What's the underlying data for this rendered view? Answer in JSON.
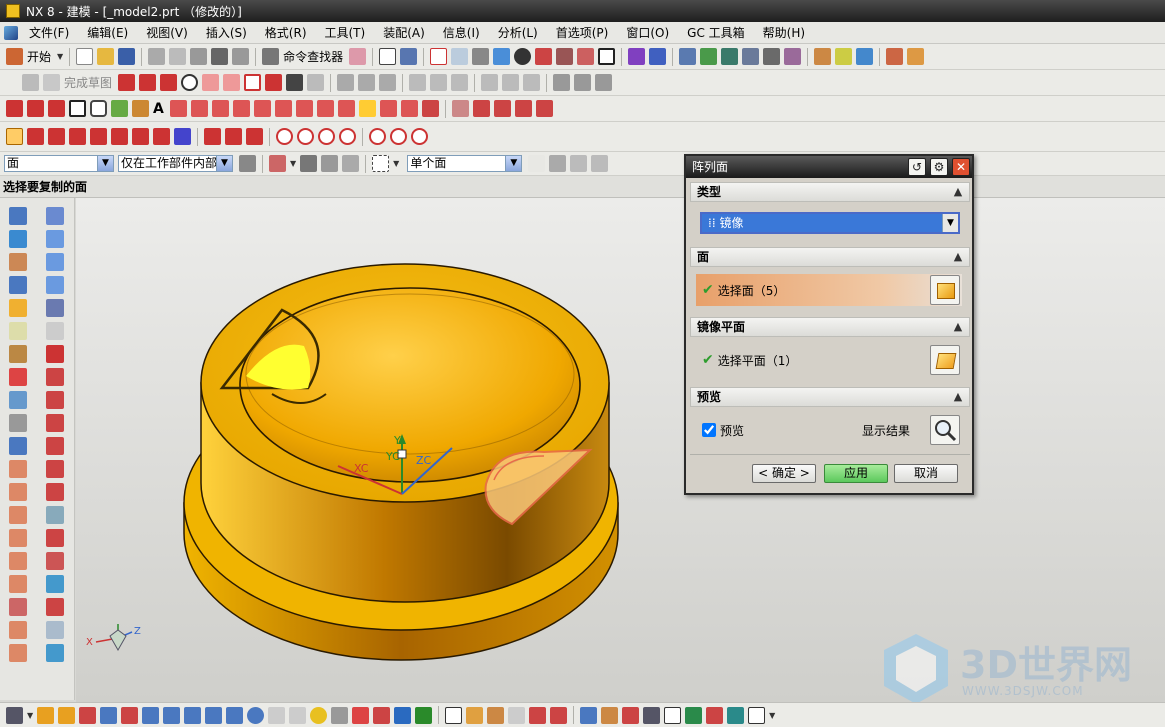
{
  "titlebar": {
    "title": "NX 8 - 建模 - [_model2.prt （修改的）]"
  },
  "menu": [
    "文件(F)",
    "编辑(E)",
    "视图(V)",
    "插入(S)",
    "格式(R)",
    "工具(T)",
    "装配(A)",
    "信息(I)",
    "分析(L)",
    "首选项(P)",
    "窗口(O)",
    "GC 工具箱",
    "帮助(H)"
  ],
  "toolbar": {
    "start_label": "开始",
    "cmd_finder_label": "命令查找器",
    "finish_sketch_label": "完成草图"
  },
  "selection": {
    "filter_type": "面",
    "scope": "仅在工作部件内部",
    "face_rule": "单个面"
  },
  "cue_line": "选择要复制的面",
  "triad_labels": {
    "xc": "XC",
    "yc": "YC",
    "zc": "ZC"
  },
  "view_triad": {
    "x": "X",
    "z": "Z"
  },
  "dialog": {
    "title": "阵列面",
    "type_section": "类型",
    "type_value": "镜像",
    "face_section": "面",
    "select_face": "选择面（5）",
    "mirror_plane_section": "镜像平面",
    "select_plane": "选择平面（1）",
    "preview_section": "预览",
    "preview_checkbox": "预览",
    "preview_checked": true,
    "show_result": "显示结果",
    "ok": "< 确定 >",
    "apply": "应用",
    "cancel": "取消"
  },
  "watermark": {
    "brand": "3D世界网",
    "url": "WWW.3DSJW.COM"
  },
  "colors": {
    "part": "#f2b400",
    "accent": "#e96a4a",
    "titlebar": "#2a2a2a",
    "apply_button": "#5cc85c"
  }
}
